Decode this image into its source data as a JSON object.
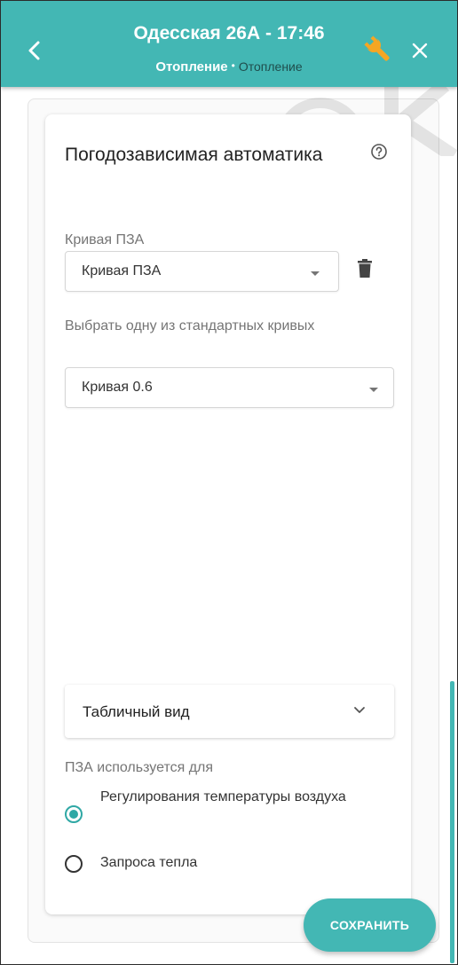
{
  "header": {
    "title": "Одесская 26А",
    "separator": "-",
    "time": "17:46",
    "subtitle_primary": "Отопление",
    "subtitle_dot": "•",
    "subtitle_secondary": "Отопление",
    "background_color": "#43b7b4",
    "wrench_color": "#f5a623",
    "icons": [
      "chevron-left-icon",
      "wrench-icon",
      "close-icon"
    ]
  },
  "card": {
    "title": "Погодозависимая автоматика",
    "help_icon": "question-circle-icon"
  },
  "curve_field": {
    "label": "Кривая ПЗА",
    "value": "Кривая ПЗА",
    "delete_icon": "trash-icon"
  },
  "standard_curve_field": {
    "label": "Выбрать одну из стандартных кривых",
    "value": "Кривая 0.6"
  },
  "table_view": {
    "label": "Табличный вид",
    "icon": "chevron-down-icon"
  },
  "usage": {
    "label": "ПЗА используется для",
    "options": [
      {
        "label": "Регулирования температуры воздуха",
        "selected": true
      },
      {
        "label": "Запроса тепла",
        "selected": false
      }
    ]
  },
  "save_button": {
    "label": "СОХРАНИТЬ"
  },
  "accent_color": "#43b7b4"
}
